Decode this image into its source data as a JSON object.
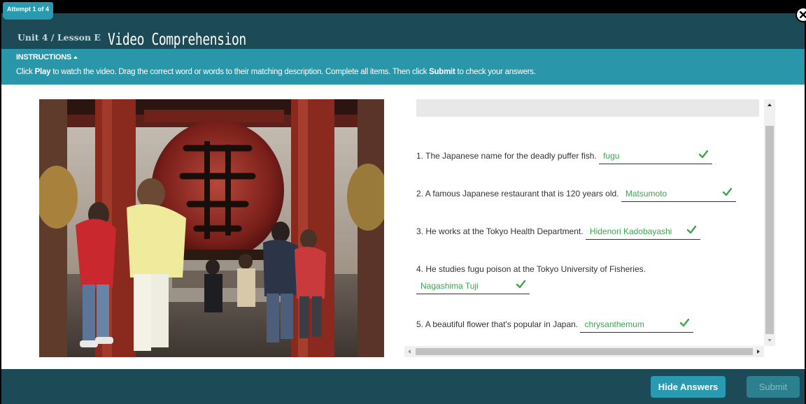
{
  "header": {
    "attempt": "Attempt 1 of 4",
    "unit": "Unit 4 / Lesson E",
    "title": "Video Comprehension"
  },
  "instructions": {
    "heading": "INSTRUCTIONS",
    "text_1": "Click ",
    "play": "Play",
    "text_2": " to watch the video. Drag the correct word or words to their matching description. Complete all items. Then click ",
    "submit": "Submit",
    "text_3": " to check your answers."
  },
  "items": [
    {
      "number": "1.",
      "text": "The Japanese name for the deadly puffer fish.",
      "answer": "fugu"
    },
    {
      "number": "2.",
      "text": "A famous Japanese restaurant that is 120 years old.",
      "answer": "Matsumoto"
    },
    {
      "number": "3.",
      "text": "He works at the Tokyo Health Department.",
      "answer": "Hidenori Kadobayashi"
    },
    {
      "number": "4.",
      "text": "He studies fugu poison at the Tokyo University of Fisheries.",
      "answer": "Nagashima Tuji"
    },
    {
      "number": "5.",
      "text": "A beautiful flower that's popular in Japan.",
      "answer": "chrysanthemum"
    }
  ],
  "footer": {
    "hide_answers": "Hide Answers",
    "submit": "Submit"
  },
  "colors": {
    "header_bg": "#1d4a57",
    "accent": "#2a9ab1",
    "correct": "#3aa74d"
  },
  "icons": {
    "close": "close-icon",
    "check": "check-icon",
    "video": "video-frame"
  }
}
